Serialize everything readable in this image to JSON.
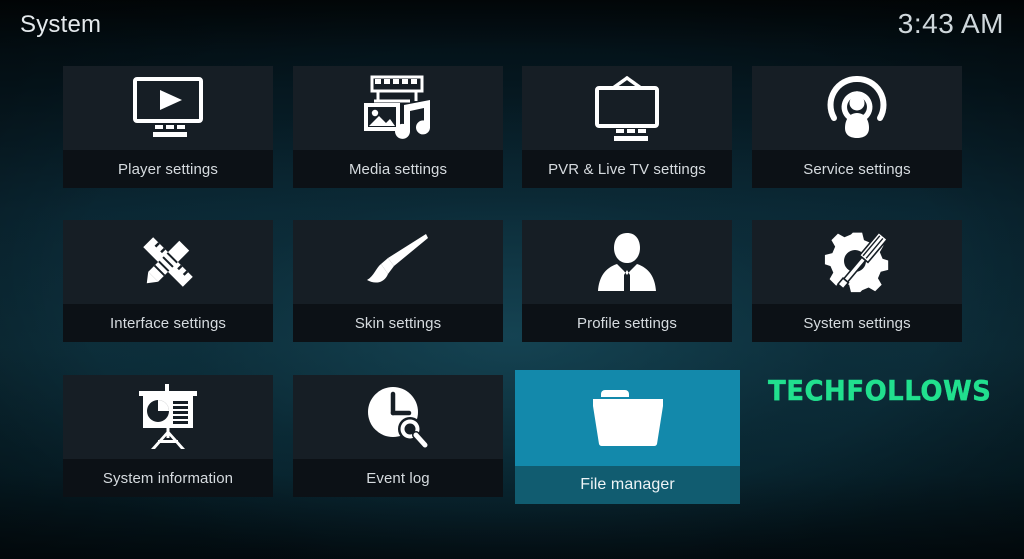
{
  "header": {
    "title": "System",
    "clock": "3:43 AM"
  },
  "colors": {
    "background_dark": "#0a2632",
    "tile_background": "#161e25",
    "tile_label_bar": "#0c1116",
    "selected_tile": "#1389ab",
    "selected_label_bar": "#115c70",
    "label_text": "#d6dbdf",
    "watermark_green": "#21e08e"
  },
  "watermark": {
    "text": "TECHFOLLOWS"
  },
  "grid": {
    "tiles": [
      {
        "label": "Player settings",
        "icon": "monitor-play-icon",
        "selected": false
      },
      {
        "label": "Media settings",
        "icon": "filmstrip-photo-music-icon",
        "selected": false
      },
      {
        "label": "PVR & Live TV settings",
        "icon": "television-antenna-icon",
        "selected": false
      },
      {
        "label": "Service settings",
        "icon": "broadcast-person-icon",
        "selected": false
      },
      {
        "label": "Interface settings",
        "icon": "pencil-ruler-icon",
        "selected": false
      },
      {
        "label": "Skin settings",
        "icon": "paintbrush-icon",
        "selected": false
      },
      {
        "label": "Profile settings",
        "icon": "person-bust-icon",
        "selected": false
      },
      {
        "label": "System settings",
        "icon": "gear-screwdriver-icon",
        "selected": false
      },
      {
        "label": "System information",
        "icon": "presentation-chart-icon",
        "selected": false
      },
      {
        "label": "Event log",
        "icon": "clock-magnifier-icon",
        "selected": false
      },
      {
        "label": "File manager",
        "icon": "folder-icon",
        "selected": true
      }
    ]
  }
}
